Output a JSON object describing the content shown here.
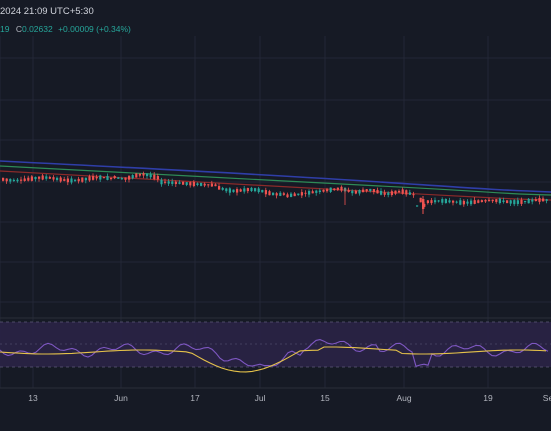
{
  "header": {
    "datetime": "2024 21:09 UTC+5:30"
  },
  "ohlc": {
    "partial": "19",
    "close_label": "C",
    "close": "0.02632",
    "change": "+0.00009 (+0.34%)"
  },
  "colors": {
    "background": "#161a25",
    "up": "#26a69a",
    "down": "#ef5350",
    "ma_blue": "#2f3ea8",
    "ma_green": "#2e8b57",
    "ma_red": "#8b2a2a",
    "rsi_line": "#7e57c2",
    "rsi_ma": "#e5c24a",
    "rsi_band": "#2a2446"
  },
  "chart_data": {
    "type": "candlestick",
    "x_ticks": [
      "13",
      "Jun",
      "17",
      "Jul",
      "15",
      "Aug",
      "19",
      "Se"
    ],
    "grid": true,
    "indicator": "RSI with moving average, bands 70/30"
  }
}
